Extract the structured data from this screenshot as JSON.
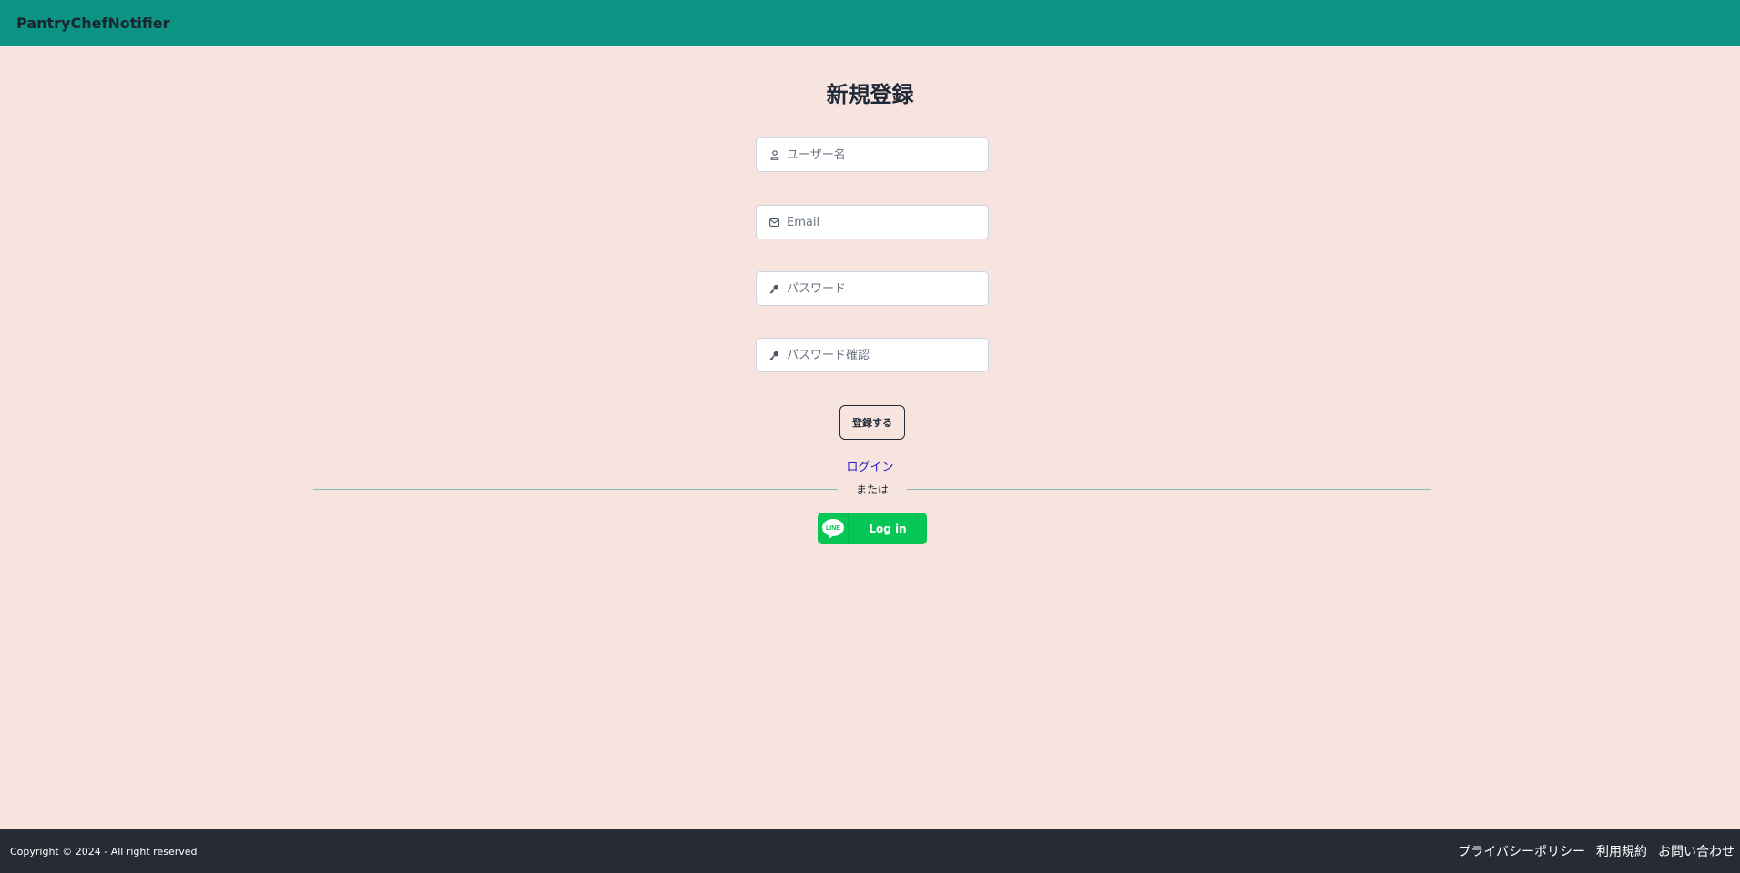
{
  "navbar": {
    "brand": "PantryChefNotifier"
  },
  "form": {
    "title": "新規登録",
    "username": {
      "placeholder": "ユーザー名",
      "value": ""
    },
    "email": {
      "placeholder": "Email",
      "value": ""
    },
    "password": {
      "placeholder": "パスワード",
      "value": ""
    },
    "password_confirm": {
      "placeholder": "パスワード確認",
      "value": ""
    },
    "submit_label": "登録する",
    "login_link": "ログイン",
    "divider_text": "または",
    "line_button_label": "Log in",
    "line_logo_text": "LINE"
  },
  "footer": {
    "copyright": "Copyright © 2024 - All right reserved",
    "links": [
      "プライバシーポリシー",
      "利用規約",
      "お問い合わせ"
    ]
  },
  "colors": {
    "navbar": "#0c9384",
    "background": "#f8e4de",
    "footer": "#262b35",
    "line_green": "#06c755",
    "link": "#2319c9"
  },
  "icons": {
    "username": "user-icon",
    "email": "envelope-icon",
    "password": "key-icon",
    "password_confirm": "key-icon"
  }
}
